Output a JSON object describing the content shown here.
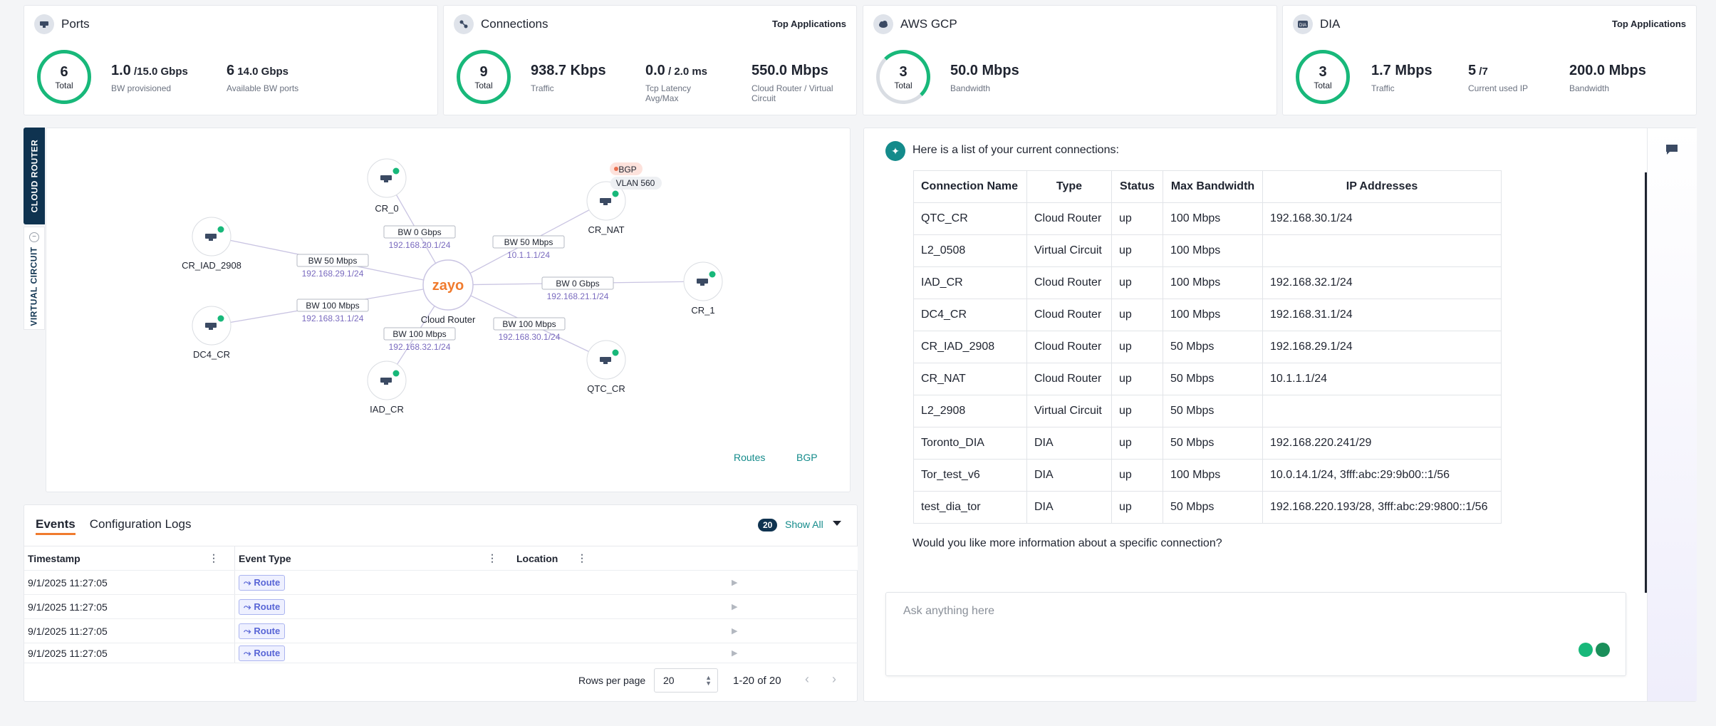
{
  "cards": [
    {
      "title": "Ports",
      "top_apps": "",
      "ring_value": "6",
      "ring_label": "Total",
      "stats": [
        {
          "main": "1.0",
          "suffix": " /15.0 Gbps",
          "label": "BW provisioned"
        },
        {
          "main": "6",
          "suffix": " 14.0 Gbps",
          "label": "Available BW ports"
        }
      ]
    },
    {
      "title": "Connections",
      "top_apps": "Top Applications",
      "ring_value": "9",
      "ring_label": "Total",
      "stats": [
        {
          "main": "938.7 Kbps",
          "suffix": "",
          "label": "Traffic"
        },
        {
          "main": "0.0",
          "suffix": " / 2.0 ms",
          "label": "Tcp Latency Avg/Max"
        },
        {
          "main": "550.0 Mbps",
          "suffix": "",
          "label": "Cloud Router / Virtual Circuit"
        }
      ]
    },
    {
      "title": "AWS  GCP",
      "top_apps": "",
      "ring_value": "3",
      "ring_label": "Total",
      "stats": [
        {
          "main": "50.0 Mbps",
          "suffix": "",
          "label": "Bandwidth"
        }
      ]
    },
    {
      "title": "DIA",
      "top_apps": "Top Applications",
      "ring_value": "3",
      "ring_label": "Total",
      "stats": [
        {
          "main": "1.7 Mbps",
          "suffix": "",
          "label": "Traffic"
        },
        {
          "main": "5",
          "suffix": " /7",
          "label": "Current used IP"
        },
        {
          "main": "200.0 Mbps",
          "suffix": "",
          "label": "Bandwidth"
        }
      ]
    }
  ],
  "side_tabs": {
    "cloud_router": "CLOUD ROUTER",
    "virtual_circuit": "VIRTUAL CIRCUIT"
  },
  "network": {
    "center_logo": "zayo",
    "center_label": "Cloud Router",
    "nodes": [
      "CR_0",
      "CR_NAT",
      "CR_IAD_2908",
      "CR_1",
      "DC4_CR",
      "QTC_CR",
      "IAD_CR"
    ],
    "bgp_badge": "BGP",
    "vlan_label": "VLAN 560",
    "links": [
      {
        "bw": "BW 0 Gbps",
        "ip": "192.168.20.1/24"
      },
      {
        "bw": "BW 50 Mbps",
        "ip": "10.1.1.1/24"
      },
      {
        "bw": "BW 50 Mbps",
        "ip": "192.168.29.1/24"
      },
      {
        "bw": "BW 0 Gbps",
        "ip": "192.168.21.1/24"
      },
      {
        "bw": "BW 100 Mbps",
        "ip": "192.168.31.1/24"
      },
      {
        "bw": "BW 100 Mbps",
        "ip": "192.168.32.1/24"
      },
      {
        "bw": "BW 100 Mbps",
        "ip": "192.168.30.1/24"
      }
    ],
    "routes_link": "Routes",
    "bgp_link": "BGP"
  },
  "events": {
    "tabs": [
      "Events",
      "Configuration Logs"
    ],
    "count": "20",
    "show_all": "Show All",
    "columns": [
      "Timestamp",
      "Event Type",
      "Location"
    ],
    "rows": [
      {
        "timestamp": "9/1/2025 11:27:05",
        "type": "Route"
      },
      {
        "timestamp": "9/1/2025 11:27:05",
        "type": "Route"
      },
      {
        "timestamp": "9/1/2025 11:27:05",
        "type": "Route"
      },
      {
        "timestamp": "9/1/2025 11:27:05",
        "type": "Route"
      }
    ],
    "rows_per_page_label": "Rows per page",
    "rows_per_page": "20",
    "range": "1-20 of 20"
  },
  "chat": {
    "intro": "Here is a list of your current connections:",
    "columns": [
      "Connection Name",
      "Type",
      "Status",
      "Max Bandwidth",
      "IP Addresses"
    ],
    "rows": [
      [
        "QTC_CR",
        "Cloud Router",
        "up",
        "100 Mbps",
        "192.168.30.1/24"
      ],
      [
        "L2_0508",
        "Virtual Circuit",
        "up",
        "100 Mbps",
        ""
      ],
      [
        "IAD_CR",
        "Cloud Router",
        "up",
        "100 Mbps",
        "192.168.32.1/24"
      ],
      [
        "DC4_CR",
        "Cloud Router",
        "up",
        "100 Mbps",
        "192.168.31.1/24"
      ],
      [
        "CR_IAD_2908",
        "Cloud Router",
        "up",
        "50 Mbps",
        "192.168.29.1/24"
      ],
      [
        "CR_NAT",
        "Cloud Router",
        "up",
        "50 Mbps",
        "10.1.1.1/24"
      ],
      [
        "L2_2908",
        "Virtual Circuit",
        "up",
        "50 Mbps",
        ""
      ],
      [
        "Toronto_DIA",
        "DIA",
        "up",
        "50 Mbps",
        "192.168.220.241/29"
      ],
      [
        "Tor_test_v6",
        "DIA",
        "up",
        "100 Mbps",
        "10.0.14.1/24, 3fff:abc:29:9b00::1/56"
      ],
      [
        "test_dia_tor",
        "DIA",
        "up",
        "50 Mbps",
        "192.168.220.193/28, 3fff:abc:29:9800::1/56"
      ]
    ],
    "question": "Would you like more information about a specific connection?",
    "input_placeholder": "Ask anything here"
  },
  "colors": {
    "accent": "#18b87a",
    "navy": "#0f3350",
    "teal": "#148b8b",
    "link_purple": "#7a6bbf"
  }
}
